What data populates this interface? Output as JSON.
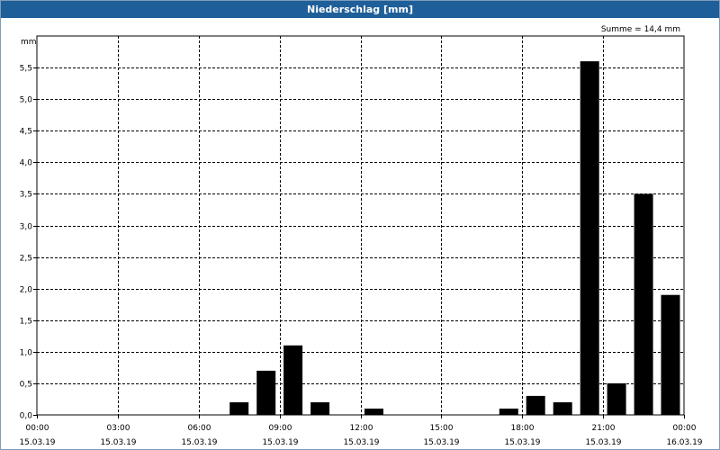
{
  "window": {
    "title": "Niederschlag [mm]"
  },
  "chart_data": {
    "type": "bar",
    "title": "Niederschlag [mm]",
    "ylabel": "mm",
    "annotation": "Summe = 14,4 mm",
    "ylim": [
      0,
      6.0
    ],
    "xlim_hours": [
      0,
      24
    ],
    "yticks": [
      {
        "v": 0,
        "label": "0,0"
      },
      {
        "v": 0.5,
        "label": "0,5"
      },
      {
        "v": 1.0,
        "label": "1,0"
      },
      {
        "v": 1.5,
        "label": "1,5"
      },
      {
        "v": 2.0,
        "label": "2,0"
      },
      {
        "v": 2.5,
        "label": "2,5"
      },
      {
        "v": 3.0,
        "label": "3,0"
      },
      {
        "v": 3.5,
        "label": "3,5"
      },
      {
        "v": 4.0,
        "label": "4,0"
      },
      {
        "v": 4.5,
        "label": "4,5"
      },
      {
        "v": 5.0,
        "label": "5,0"
      },
      {
        "v": 5.5,
        "label": "5,5"
      }
    ],
    "xticks": [
      {
        "t": 0,
        "time": "00:00",
        "date": "15.03.19"
      },
      {
        "t": 3,
        "time": "03:00",
        "date": "15.03.19"
      },
      {
        "t": 6,
        "time": "06:00",
        "date": "15.03.19"
      },
      {
        "t": 9,
        "time": "09:00",
        "date": "15.03.19"
      },
      {
        "t": 12,
        "time": "12:00",
        "date": "15.03.19"
      },
      {
        "t": 15,
        "time": "15:00",
        "date": "15.03.19"
      },
      {
        "t": 18,
        "time": "18:00",
        "date": "15.03.19"
      },
      {
        "t": 21,
        "time": "21:00",
        "date": "15.03.19"
      },
      {
        "t": 24,
        "time": "00:00",
        "date": "16.03.19"
      }
    ],
    "bars": [
      {
        "t": 7.5,
        "value": 0.2
      },
      {
        "t": 8.5,
        "value": 0.7
      },
      {
        "t": 9.5,
        "value": 1.1
      },
      {
        "t": 10.5,
        "value": 0.2
      },
      {
        "t": 12.5,
        "value": 0.1
      },
      {
        "t": 17.5,
        "value": 0.1
      },
      {
        "t": 18.5,
        "value": 0.3
      },
      {
        "t": 19.5,
        "value": 0.2
      },
      {
        "t": 20.5,
        "value": 5.6
      },
      {
        "t": 21.5,
        "value": 0.5
      },
      {
        "t": 22.5,
        "value": 3.5
      },
      {
        "t": 23.5,
        "value": 1.9
      }
    ],
    "bar_color": "#000000",
    "grid": true,
    "legend": "none"
  }
}
